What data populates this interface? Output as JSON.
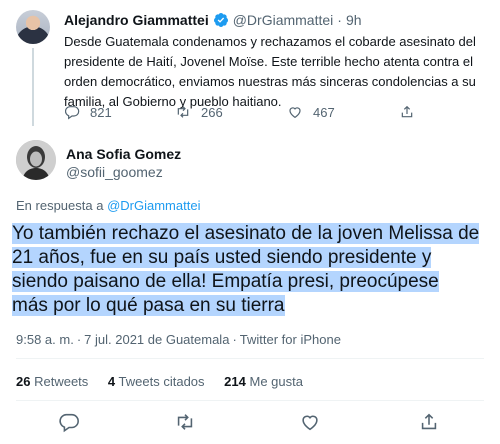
{
  "quoted_tweet": {
    "author_name": "Alejandro Giammattei",
    "handle": "@DrGiammattei",
    "separator": "·",
    "time": "9h",
    "text": "Desde Guatemala condenamos y rechazamos el cobarde asesinato del presidente de Haití, Jovenel Moïse. Este terrible hecho atenta contra el orden democrático, enviamos nuestras más sinceras condolencias a su familia, al Gobierno y pueblo haitiano.",
    "replies": "821",
    "retweets": "266",
    "likes": "467"
  },
  "tweet": {
    "author_name": "Ana Sofia Gomez",
    "handle": "@sofii_goomez",
    "reply_prefix": "En respuesta a",
    "reply_to": "@DrGiammattei",
    "text_lines": [
      "Yo también rechazo el asesinato de la joven Melissa de",
      "21 años, fue en su país usted siendo presidente y",
      "siendo paisano de ella!  Empatía presi, preocúpese",
      "más por lo qué pasa en su tierra"
    ],
    "time": "9:58 a. m.",
    "separator": "·",
    "date": "7 jul. 2021 de Guatemala",
    "source": "Twitter for iPhone"
  },
  "stats": {
    "retweets_count": "26",
    "retweets_label": "Retweets",
    "quotes_count": "4",
    "quotes_label": "Tweets citados",
    "likes_count": "214",
    "likes_label": "Me gusta"
  },
  "icons": {
    "reply": "reply-icon",
    "retweet": "retweet-icon",
    "like": "heart-icon",
    "share": "share-icon",
    "verified": "verified-badge-icon"
  },
  "colors": {
    "accent": "#1d9bf0",
    "highlight": "#b4d5fe",
    "secondary_text": "#536471"
  }
}
